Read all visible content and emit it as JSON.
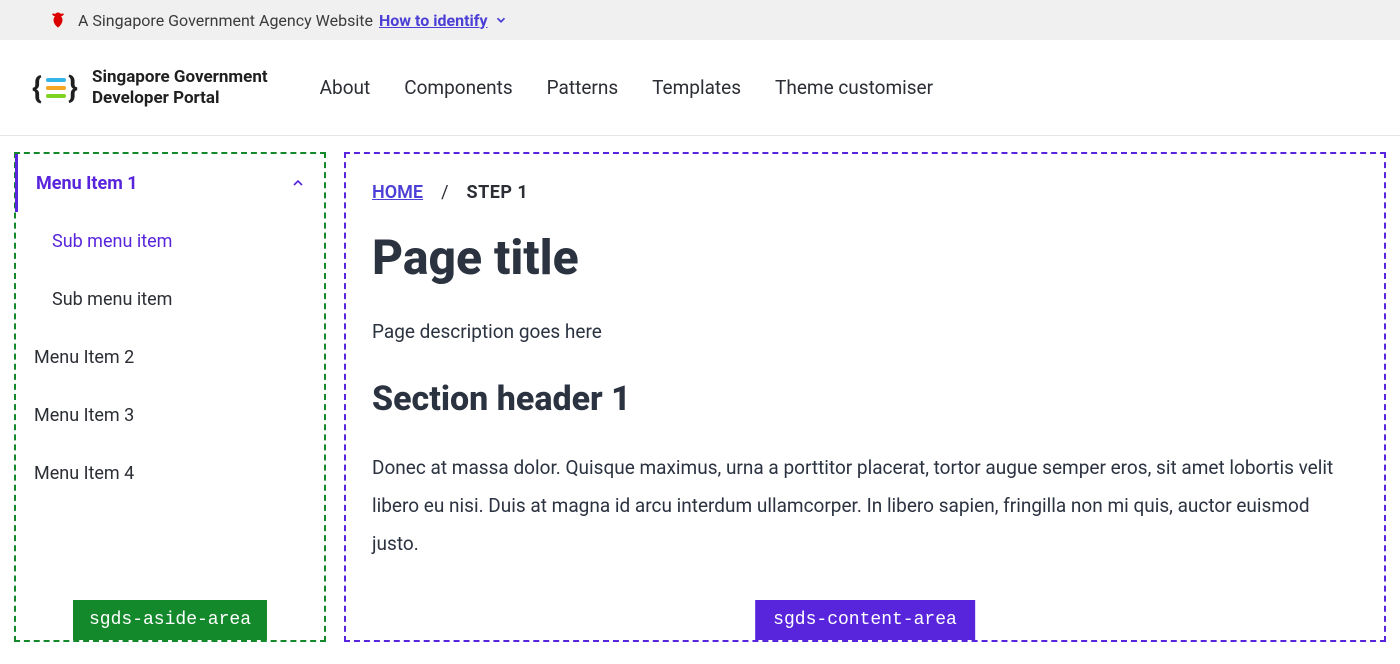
{
  "gov_banner": {
    "text": "A Singapore Government Agency Website",
    "link": "How to identify"
  },
  "brand": {
    "line1": "Singapore Government",
    "line2": "Developer Portal"
  },
  "nav": {
    "about": "About",
    "components": "Components",
    "patterns": "Patterns",
    "templates": "Templates",
    "theme": "Theme customiser"
  },
  "sidebar": {
    "item1": "Menu Item 1",
    "sub1": "Sub menu item",
    "sub2": "Sub menu item",
    "item2": "Menu Item 2",
    "item3": "Menu Item 3",
    "item4": "Menu Item 4",
    "area_label": "sgds-aside-area"
  },
  "breadcrumb": {
    "home": "HOME",
    "sep": "/",
    "current": "STEP 1"
  },
  "content": {
    "title": "Page title",
    "description": "Page description goes here",
    "section_header": "Section header 1",
    "body": "Donec at massa dolor. Quisque maximus, urna a porttitor placerat, tortor augue semper eros, sit amet lobortis velit libero eu nisi. Duis at magna id arcu interdum ullamcorper. In libero sapien, fringilla non mi quis, auctor euismod justo.",
    "area_label": "sgds-content-area"
  }
}
